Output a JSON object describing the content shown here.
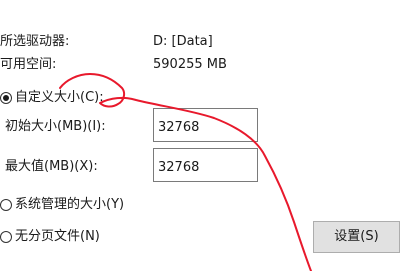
{
  "drive_info": {
    "selected_drive_label": "所选驱动器:",
    "selected_drive_value": "D:  [Data]",
    "free_space_label": "可用空间:",
    "free_space_value": "590255 MB"
  },
  "paging_options": {
    "custom_size_label": "自定义大小(C):",
    "initial_size_label": "初始大小(MB)(I):",
    "initial_size_value": "32768",
    "max_size_label": "最大值(MB)(X):",
    "max_size_value": "32768",
    "system_managed_label": "系统管理的大小(Y)",
    "no_paging_file_label": "无分页文件(N)",
    "set_button_label": "设置(S)",
    "selected_option": "custom"
  },
  "annotation": {
    "stroke_color": "#e8192c"
  }
}
